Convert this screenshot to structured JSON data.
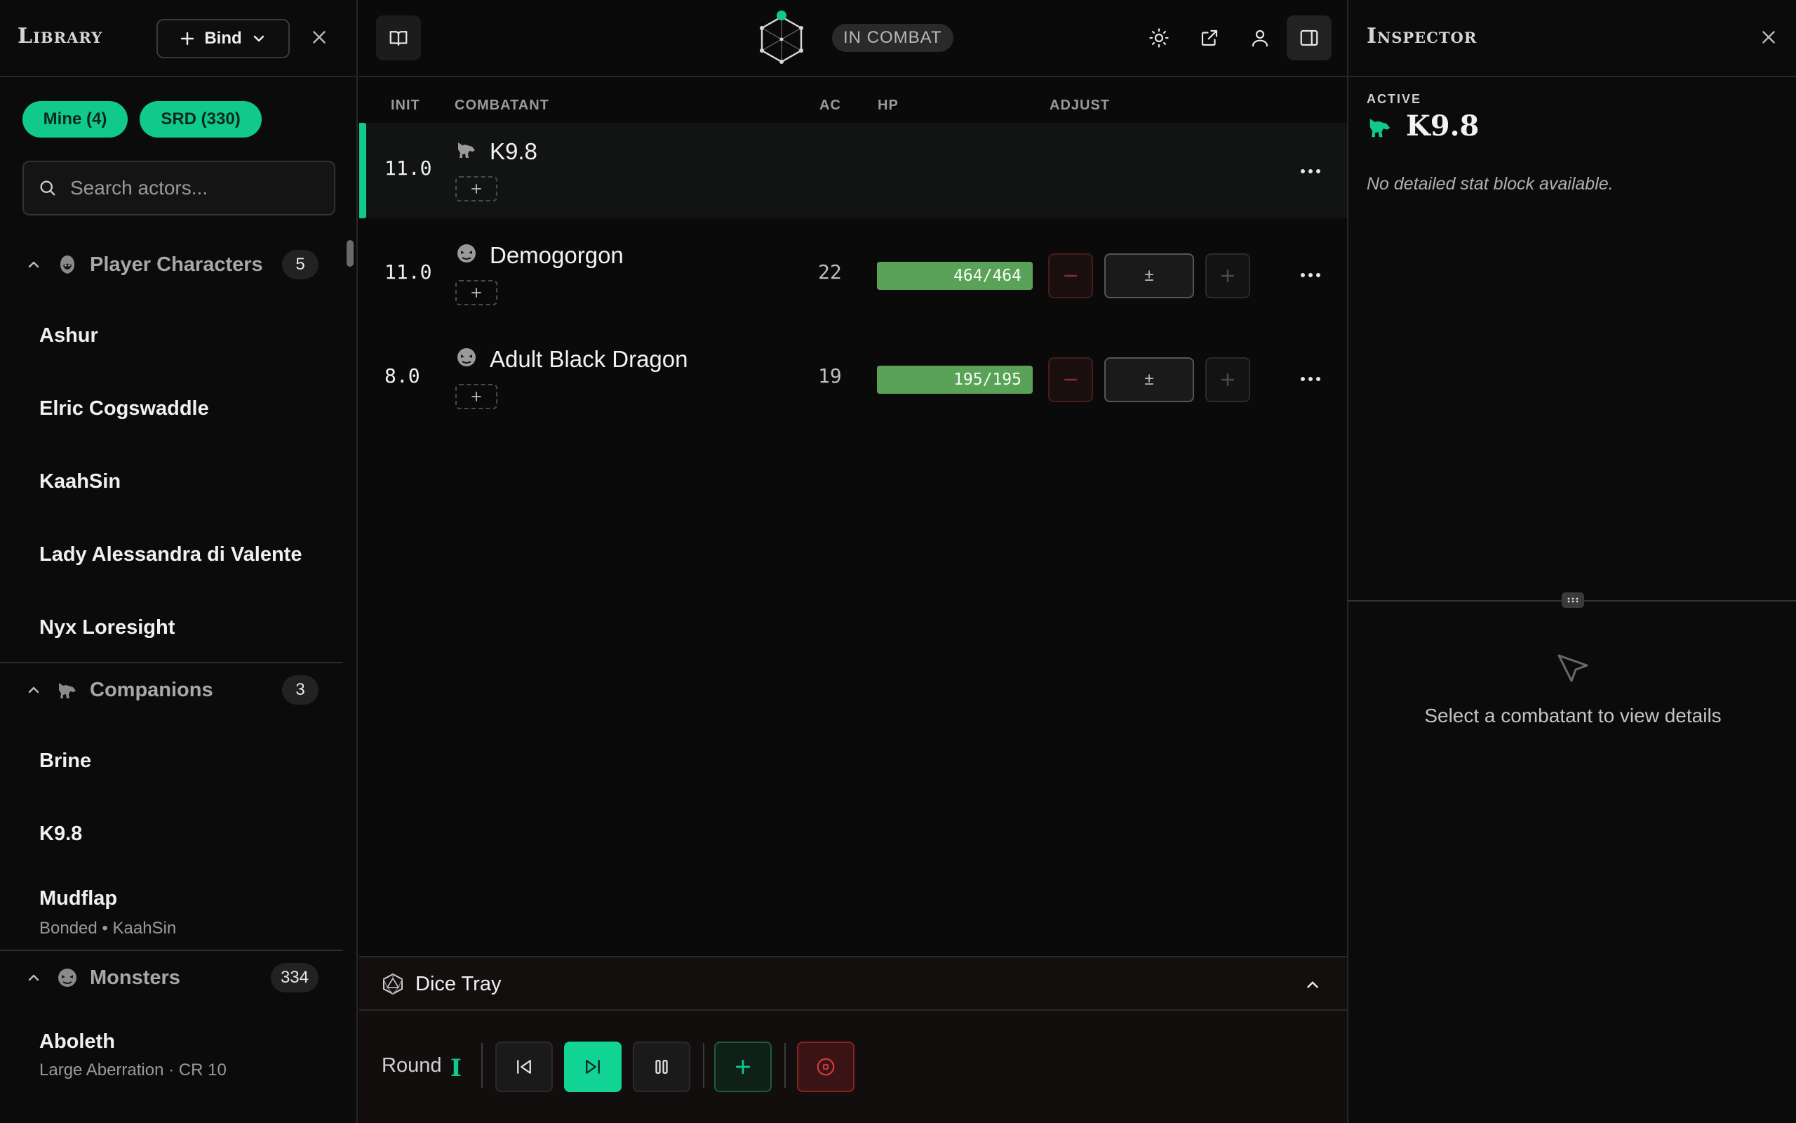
{
  "library": {
    "title": "Library",
    "bind_label": "Bind",
    "filters": [
      {
        "label": "Mine (4)"
      },
      {
        "label": "SRD (330)"
      }
    ],
    "search": {
      "placeholder": "Search actors..."
    },
    "groups": {
      "player_characters": {
        "label": "Player Characters",
        "count": "5",
        "items": [
          {
            "name": "Ashur"
          },
          {
            "name": "Elric Cogswaddle"
          },
          {
            "name": "KaahSin"
          },
          {
            "name": "Lady Alessandra di Valente"
          },
          {
            "name": "Nyx Loresight"
          }
        ]
      },
      "companions": {
        "label": "Companions",
        "count": "3",
        "items": [
          {
            "name": "Brine"
          },
          {
            "name": "K9.8"
          },
          {
            "name": "Mudflap",
            "sub": "Bonded • KaahSin"
          }
        ]
      },
      "monsters": {
        "label": "Monsters",
        "count": "334",
        "items": [
          {
            "name": "Aboleth",
            "sub": "Large Aberration · CR 10"
          }
        ]
      }
    }
  },
  "topbar": {
    "status": "IN COMBAT",
    "accent_color": "#10c98a"
  },
  "tracker": {
    "columns": {
      "init": "INIT",
      "combatant": "COMBATANT",
      "ac": "AC",
      "hp": "HP",
      "adjust": "ADJUST"
    },
    "rows": [
      {
        "init": "11.0",
        "name": "K9.8",
        "icon": "wolf-icon",
        "active": true
      },
      {
        "init": "11.0",
        "name": "Demogorgon",
        "icon": "monster-icon",
        "ac": "22",
        "hp": "464/464",
        "hp_fraction": 1.0,
        "adjust_placeholder": "±"
      },
      {
        "init": "8.0",
        "name": "Adult Black Dragon",
        "icon": "monster-icon",
        "ac": "19",
        "hp": "195/195",
        "hp_fraction": 1.0,
        "adjust_placeholder": "±"
      }
    ]
  },
  "dice_tray": {
    "label": "Dice Tray"
  },
  "round": {
    "label": "Round",
    "value": "I"
  },
  "inspector": {
    "title": "Inspector",
    "active_label": "ACTIVE",
    "active_name": "K9.8",
    "no_stat": "No detailed stat block available.",
    "empty_message": "Select a combatant to view details"
  }
}
